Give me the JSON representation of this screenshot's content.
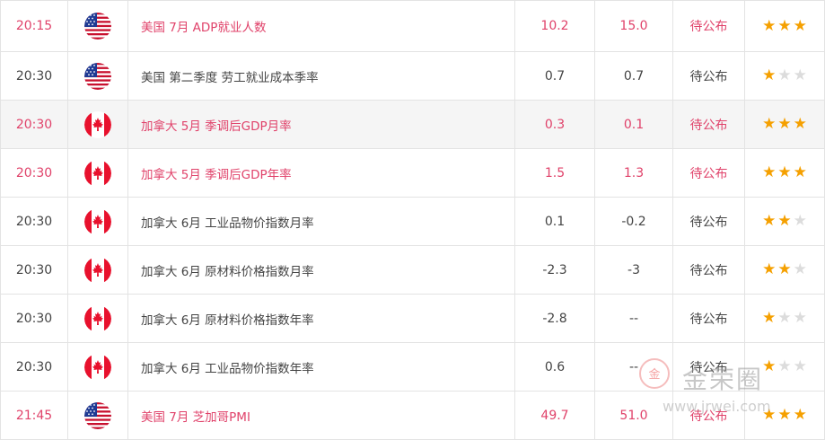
{
  "rows": [
    {
      "time": "20:15",
      "country": "us",
      "name": "美国 7月 ADP就业人数",
      "previous": "10.2",
      "forecast": "15.0",
      "actual": "待公布",
      "importance": 3,
      "highlight": true
    },
    {
      "time": "20:30",
      "country": "us",
      "name": "美国 第二季度 劳工就业成本季率",
      "previous": "0.7",
      "forecast": "0.7",
      "actual": "待公布",
      "importance": 1,
      "highlight": false
    },
    {
      "time": "20:30",
      "country": "ca",
      "name": "加拿大 5月 季调后GDP月率",
      "previous": "0.3",
      "forecast": "0.1",
      "actual": "待公布",
      "importance": 3,
      "highlight": true
    },
    {
      "time": "20:30",
      "country": "ca",
      "name": "加拿大 5月 季调后GDP年率",
      "previous": "1.5",
      "forecast": "1.3",
      "actual": "待公布",
      "importance": 3,
      "highlight": true
    },
    {
      "time": "20:30",
      "country": "ca",
      "name": "加拿大 6月 工业品物价指数月率",
      "previous": "0.1",
      "forecast": "-0.2",
      "actual": "待公布",
      "importance": 2,
      "highlight": false
    },
    {
      "time": "20:30",
      "country": "ca",
      "name": "加拿大 6月 原材料价格指数月率",
      "previous": "-2.3",
      "forecast": "-3",
      "actual": "待公布",
      "importance": 2,
      "highlight": false
    },
    {
      "time": "20:30",
      "country": "ca",
      "name": "加拿大 6月 原材料价格指数年率",
      "previous": "-2.8",
      "forecast": "--",
      "actual": "待公布",
      "importance": 1,
      "highlight": false
    },
    {
      "time": "20:30",
      "country": "ca",
      "name": "加拿大 6月 工业品物价指数年率",
      "previous": "0.6",
      "forecast": "--",
      "actual": "待公布",
      "importance": 1,
      "highlight": false
    },
    {
      "time": "21:45",
      "country": "us",
      "name": "美国 7月 芝加哥PMI",
      "previous": "49.7",
      "forecast": "51.0",
      "actual": "待公布",
      "importance": 3,
      "highlight": true
    }
  ],
  "watermark": {
    "logo_text": "金",
    "brand": "金荣圈",
    "url": "www.jrwei.com"
  },
  "colors": {
    "highlight": "#e0426a",
    "normal": "#444444",
    "star": "#f5a000",
    "star_off": "#dcdcdc",
    "alt_row": "#f5f5f5"
  },
  "icons": {
    "us": "us-flag-icon",
    "ca": "canada-flag-icon",
    "star_on": "star-filled-icon",
    "star_off": "star-empty-icon"
  }
}
